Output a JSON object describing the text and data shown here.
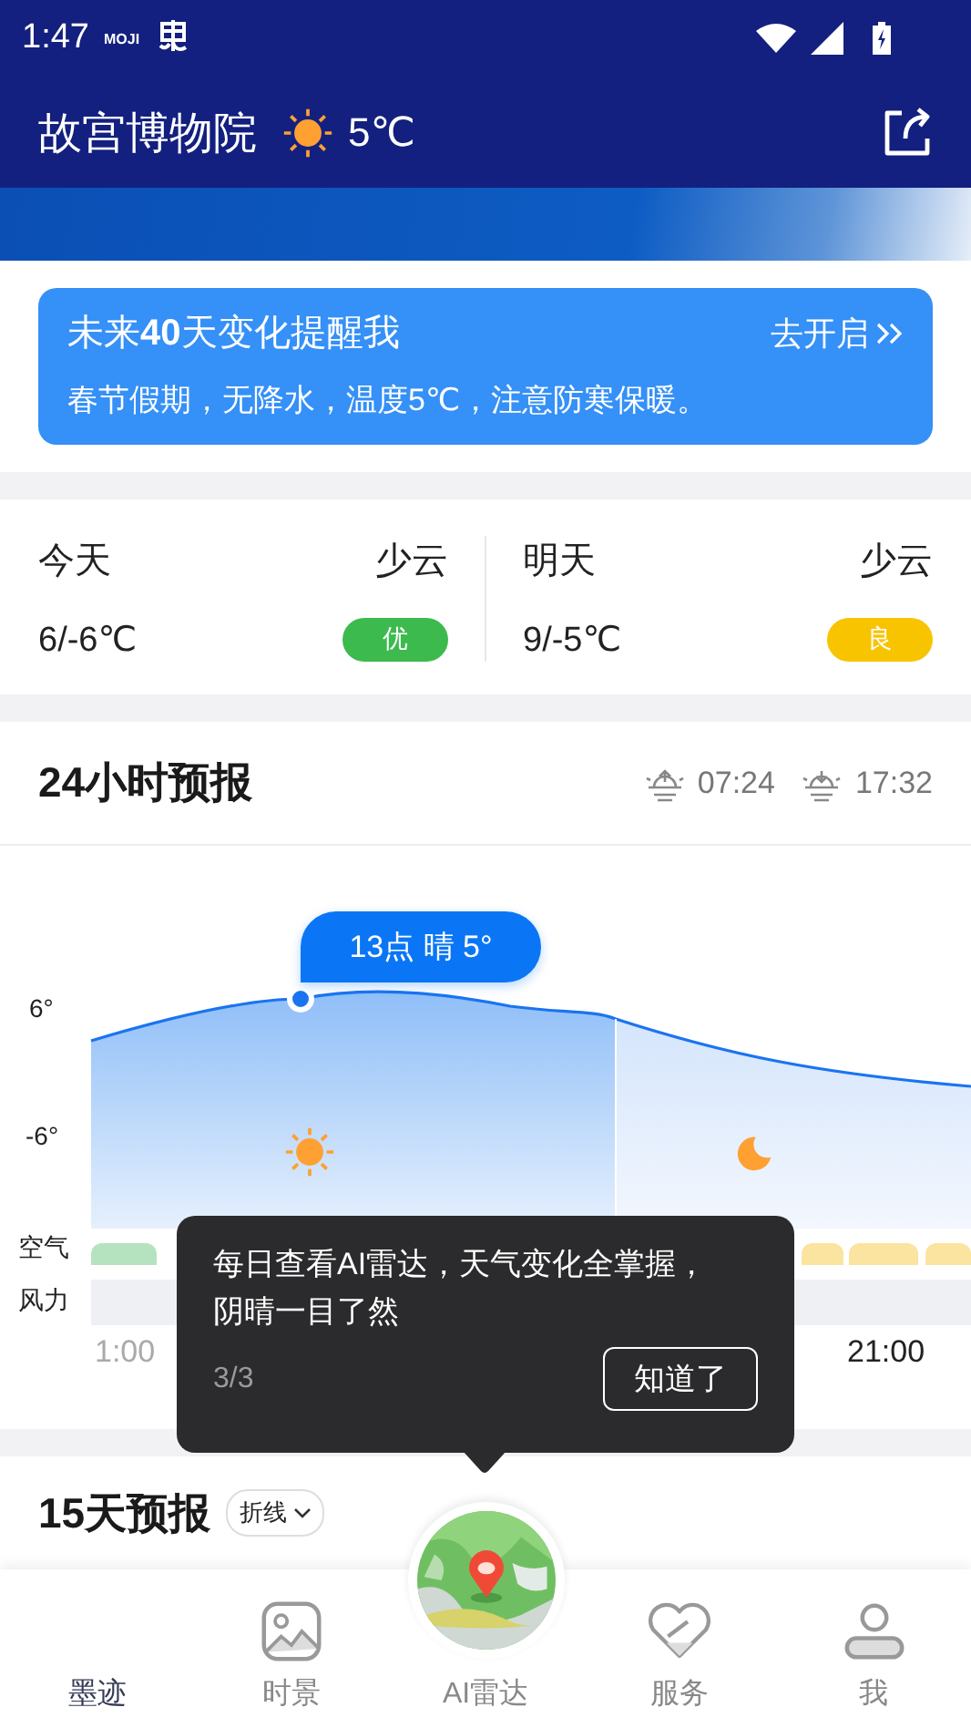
{
  "status_bar": {
    "time": "1:47",
    "app_label": "MOJI"
  },
  "header": {
    "location": "故宫博物院",
    "temperature": "5℃"
  },
  "reminder": {
    "title": "未来**40**天变化提醒我",
    "action": "去开启",
    "message": "春节假期，无降水，温度5℃，注意防寒保暖。"
  },
  "days": [
    {
      "name": "今天",
      "condition": "少云",
      "temps": "6/-6℃",
      "aqi": "优",
      "color": "#3dba4e"
    },
    {
      "name": "明天",
      "condition": "少云",
      "temps": "9/-5℃",
      "aqi": "良",
      "color": "#f8c400"
    }
  ],
  "hourly": {
    "title": "24小时预报",
    "sunrise": "07:24",
    "sunset": "17:32",
    "tooltip": "13点 晴 5°",
    "y_labels": [
      "6°",
      "-6°"
    ],
    "air_label": "空气",
    "wind_label": "风力",
    "air_segments": [
      {
        "color": "#b5e3bf"
      },
      {
        "color": "#fbe3a0"
      },
      {
        "color": "#fbe3a0"
      },
      {
        "color": "#fbe3a0"
      }
    ],
    "times": [
      "1:00",
      "21:00"
    ]
  },
  "forecast15": {
    "title": "15天预报",
    "mode": "折线"
  },
  "guide": {
    "message": "每日查看AI雷达，天气变化全掌握，阴晴一目了然",
    "step": "3/3",
    "button": "知道了"
  },
  "nav": [
    {
      "label": "墨迹",
      "selected": true,
      "kind": "home"
    },
    {
      "label": "时景",
      "selected": false
    },
    {
      "label": "AI雷达",
      "selected": false,
      "kind": "radar"
    },
    {
      "label": "服务",
      "selected": false,
      "kind": "service"
    },
    {
      "label": "我",
      "selected": false,
      "kind": "profile"
    }
  ]
}
